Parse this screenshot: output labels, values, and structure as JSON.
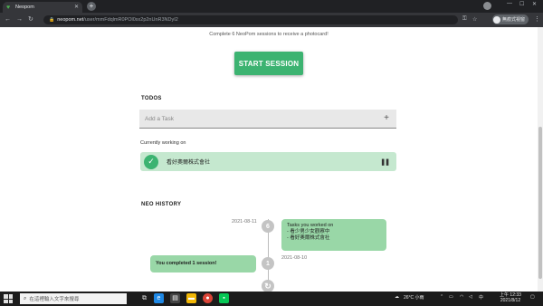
{
  "browser": {
    "tab_title": "Neopom",
    "url_host": "neopom.net",
    "url_path": "/user/mmFdqlmR0POl0sx2p2nUnR3NDyI2",
    "profile_label": "無痕式視窗"
  },
  "page": {
    "intro_text": "Complete 6 NeoPom sessions to receive a photocard!",
    "start_button": "START SESSION",
    "todos_title": "TODOS",
    "task_placeholder": "Add a Task",
    "working_label": "Currently working on",
    "working_task": "看好奧爾株式會社",
    "history_title": "NEO HISTORY",
    "history": [
      {
        "node_label": "6",
        "date": "2021-08-11",
        "card_title": "Tasks you worked on",
        "card_lines": [
          "- 看少男少女觀察中",
          "- 看好奧爾株式會社"
        ]
      },
      {
        "node_label": "1",
        "date": "2021-08-10",
        "card_text": "You completed 1 session!"
      }
    ]
  },
  "taskbar": {
    "search_placeholder": "在這裡輸入文字來搜尋",
    "weather": "26°C 小雨",
    "time": "上午 12:33",
    "date": "2021/8/12"
  },
  "colors": {
    "accent_green": "#3cb371",
    "card_green": "#99d7a7",
    "working_green": "#c5e8cf"
  },
  "icons": [
    "neopom-favicon",
    "lock-icon",
    "key-icon",
    "star-icon",
    "check-icon",
    "pause-icon",
    "plus-icon",
    "refresh-icon",
    "search-icon"
  ]
}
